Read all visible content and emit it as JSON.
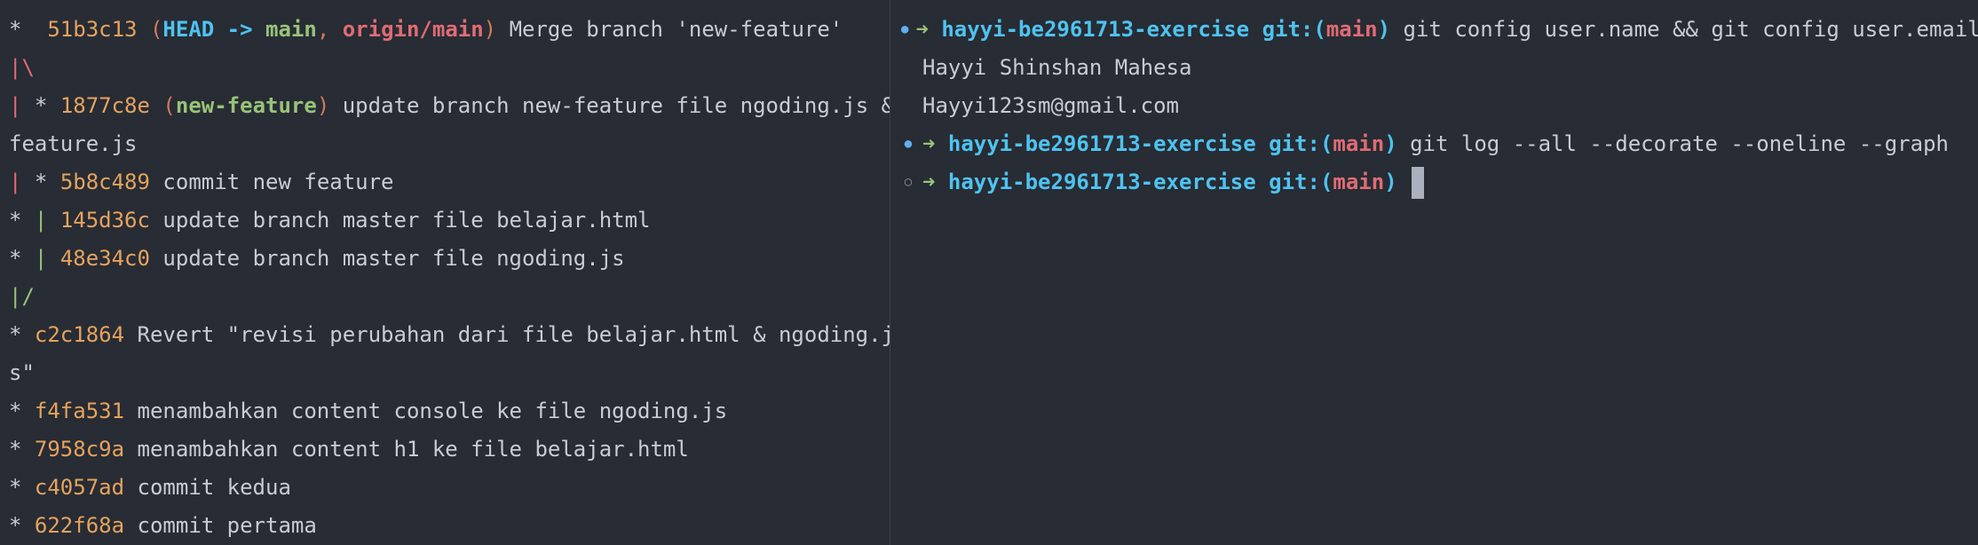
{
  "graph": [
    {
      "graph": "*  ",
      "hash": "51b3c13",
      "refs": [
        {
          "text": "HEAD -> ",
          "kind": "head"
        },
        {
          "text": "main",
          "kind": "main"
        },
        {
          "text": ", ",
          "kind": "comma"
        },
        {
          "text": "origin/main",
          "kind": "origin"
        }
      ],
      "msg": "Merge branch 'new-feature'"
    },
    {
      "graph_red": "|\\",
      "msg": ""
    },
    {
      "graph_red": "| ",
      "graph": "* ",
      "hash": "1877c8e",
      "refs": [
        {
          "text": "new-feature",
          "kind": "feature"
        }
      ],
      "msg": "update branch new-feature file ngoding.js &"
    },
    {
      "cont": "feature.js"
    },
    {
      "graph_red": "| ",
      "graph": "* ",
      "hash": "5b8c489",
      "msg": "commit new feature"
    },
    {
      "graph": "* ",
      "graph_green": "| ",
      "hash": "145d36c",
      "msg": "update branch master file belajar.html"
    },
    {
      "graph": "* ",
      "graph_green": "| ",
      "hash": "48e34c0",
      "msg": "update branch master file ngoding.js"
    },
    {
      "graph_green": "|/",
      "msg": ""
    },
    {
      "graph": "* ",
      "hash": "c2c1864",
      "msg": "Revert \"revisi perubahan dari file belajar.html & ngoding.j"
    },
    {
      "cont": "s\""
    },
    {
      "graph": "* ",
      "hash": "f4fa531",
      "msg": "menambahkan content console ke file ngoding.js"
    },
    {
      "graph": "* ",
      "hash": "7958c9a",
      "msg": "menambahkan content h1 ke file belajar.html"
    },
    {
      "graph": "* ",
      "hash": "c4057ad",
      "msg": "commit kedua"
    },
    {
      "graph": "* ",
      "hash": "622f68a",
      "msg": "commit pertama"
    }
  ],
  "terminal": {
    "prompt_arrow": "➜",
    "dir": "hayyi-be2961713-exercise",
    "git_label": "git:(",
    "branch": "main",
    "git_close": ")",
    "cmd1": "git config user.name && git config user.email",
    "out1": "Hayyi Shinshan Mahesa",
    "out2": "Hayyi123sm@gmail.com",
    "cmd2": "git log --all --decorate --oneline --graph",
    "cmd3": "",
    "dot_filled": "●",
    "dot_empty": "○"
  },
  "colors": {
    "background": "#282c34",
    "hash": "#e5a35f",
    "head": "#4ec3f0",
    "main": "#98c379",
    "origin": "#e06c75",
    "branch": "#e06c75",
    "dir": "#4ec3f0"
  }
}
